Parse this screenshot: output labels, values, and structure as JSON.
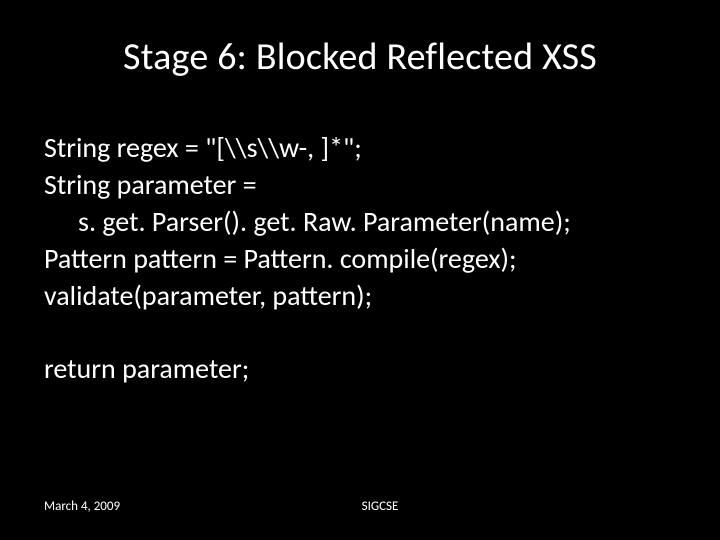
{
  "title": "Stage  6: Blocked Reflected XSS",
  "code": {
    "l1": "String regex = \"[\\\\s\\\\w-, ]*\";",
    "l2": "String parameter =",
    "l3": "s. get. Parser(). get. Raw. Parameter(name);",
    "l4": "Pattern pattern = Pattern. compile(regex);",
    "l5": "validate(parameter, pattern);",
    "l6": "return parameter;"
  },
  "footer": {
    "date": "March 4, 2009",
    "event": "SIGCSE"
  }
}
